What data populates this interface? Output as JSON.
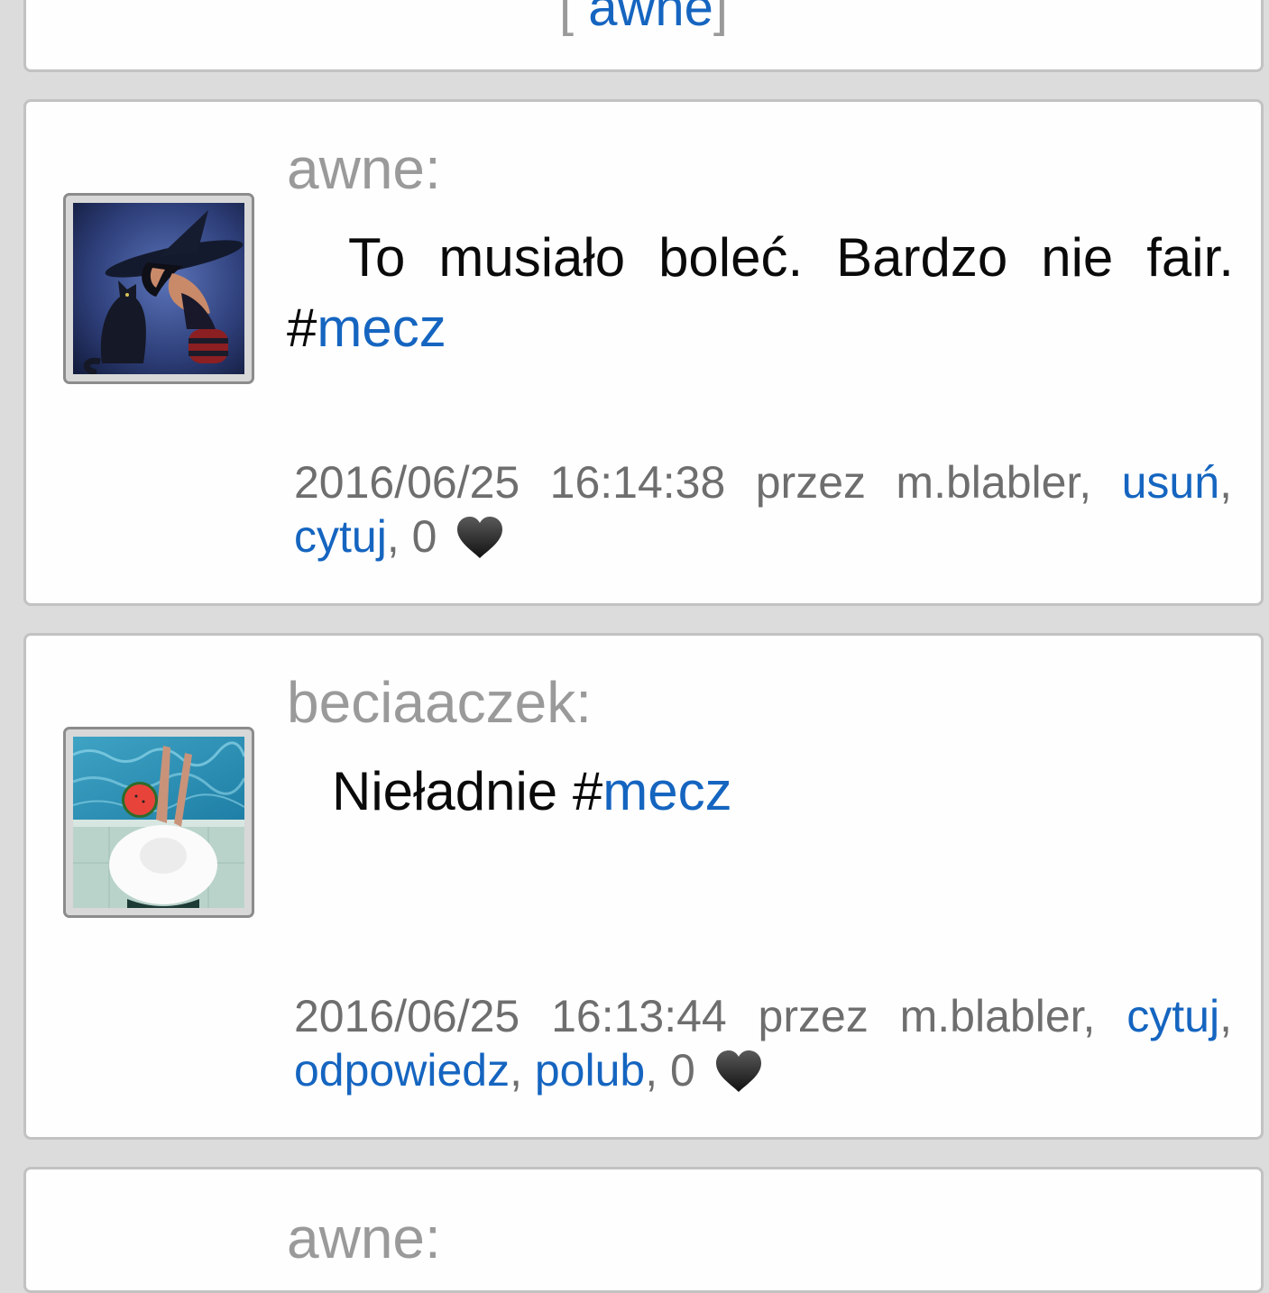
{
  "top_card": {
    "bracket_open": "[",
    "author_link": "awne",
    "bracket_close": "]"
  },
  "posts": [
    {
      "author": "awne:",
      "avatar": "witch-with-cat-avatar",
      "message_line1": [
        "To",
        "musiało",
        "boleć.",
        "Bardzo",
        "nie",
        "fair."
      ],
      "hash": "#",
      "tag": "mecz",
      "meta": {
        "date": "2016/06/25",
        "time": "16:14:38",
        "przez": "przez",
        "user": "m.blabler,",
        "action1": "usuń",
        "action2": "cytuj",
        "count": "0"
      }
    },
    {
      "author": "beciaaczek:",
      "avatar": "woman-by-pool-avatar",
      "message_text": "Nieładnie ",
      "hash": "#",
      "tag": "mecz",
      "meta": {
        "date": "2016/06/25",
        "time": "16:13:44",
        "przez": "przez",
        "user": "m.blabler,",
        "action1": "cytuj",
        "action2": "odpowiedz",
        "action3": "polub",
        "count": "0"
      }
    },
    {
      "author": "awne:"
    }
  ],
  "colors": {
    "background": "#dcdcdc",
    "card": "#fefefe",
    "link": "#1565c0",
    "muted": "#9a9a9a",
    "meta": "#6e6e6e"
  },
  "icons": [
    "heart-icon"
  ]
}
